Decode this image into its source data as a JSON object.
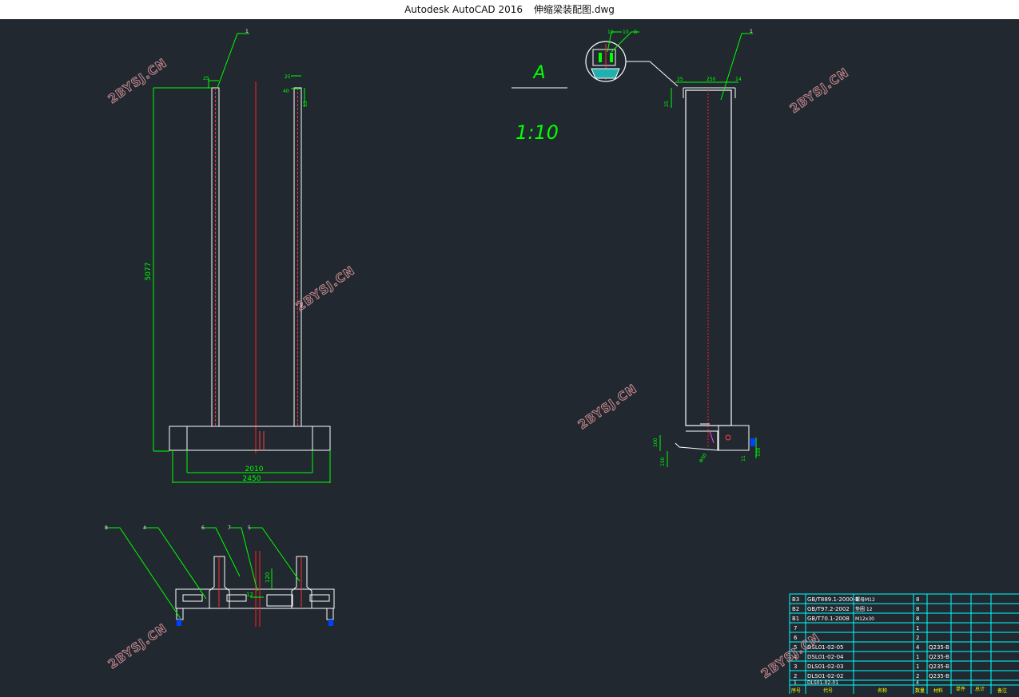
{
  "window": {
    "app_title": "Autodesk AutoCAD 2016",
    "file_name": "伸缩梁装配图.dwg"
  },
  "watermark": "2BYSJ.CN",
  "colors": {
    "background": "#212830",
    "geometry": "#ffffff",
    "dimension": "#00ff00",
    "centerline": "#ff2020",
    "table": "#00ffff",
    "table_text": "#ffff00"
  },
  "detail": {
    "label": "A",
    "scale": "1:10"
  },
  "dims": {
    "front_height": "5077",
    "front_inner_width": "2010",
    "front_outer_width": "2450",
    "top_small_1": "25",
    "top_small_2": "25",
    "top_small_3": "40",
    "top_small_4": "13",
    "side_top_1": "25",
    "side_top_2": "250",
    "side_top_3": "14",
    "side_left": "25",
    "side_bottom_1": "100",
    "side_bottom_2": "150",
    "side_bottom_3": "100",
    "side_diameter": "Φ50",
    "side_right": "11",
    "plan_dim_1": "120",
    "plan_dim_2": "12"
  },
  "leaders": {
    "front_top": "1",
    "side_top": "1",
    "detail_1": "10",
    "detail_2": "10",
    "detail_3": "B",
    "plan": [
      "8",
      "4",
      "6",
      "7",
      "5"
    ]
  },
  "bom": {
    "rows": [
      {
        "no": "B3",
        "code": "GB/T889.1-2000-1",
        "name": "螺母M12",
        "qty": "8",
        "material": ""
      },
      {
        "no": "B2",
        "code": "GB/T97.2-2002",
        "name": "垫圈 12",
        "qty": "8",
        "material": ""
      },
      {
        "no": "B1",
        "code": "GB/T70.1-2008",
        "name": "M12x30",
        "qty": "8",
        "material": ""
      },
      {
        "no": "7",
        "code": "",
        "name": "",
        "qty": "1",
        "material": ""
      },
      {
        "no": "6",
        "code": "",
        "name": "",
        "qty": "2",
        "material": ""
      },
      {
        "no": "5",
        "code": "DSL01-02-05",
        "name": "",
        "qty": "4",
        "material": "Q235-B"
      },
      {
        "no": "4",
        "code": "DSL01-02-04",
        "name": "",
        "qty": "1",
        "material": "Q235-B"
      },
      {
        "no": "3",
        "code": "DLS01-02-03",
        "name": "",
        "qty": "1",
        "material": "Q235-B"
      },
      {
        "no": "2",
        "code": "DLS01-02-02",
        "name": "",
        "qty": "2",
        "material": "Q235-B"
      },
      {
        "no": "1",
        "code": "DLS01-02-01",
        "name": "",
        "qty": "4",
        "material": ""
      }
    ],
    "header": [
      "序号",
      "代号",
      "名称",
      "数量",
      "材料",
      "单件",
      "总计",
      "备注"
    ]
  }
}
